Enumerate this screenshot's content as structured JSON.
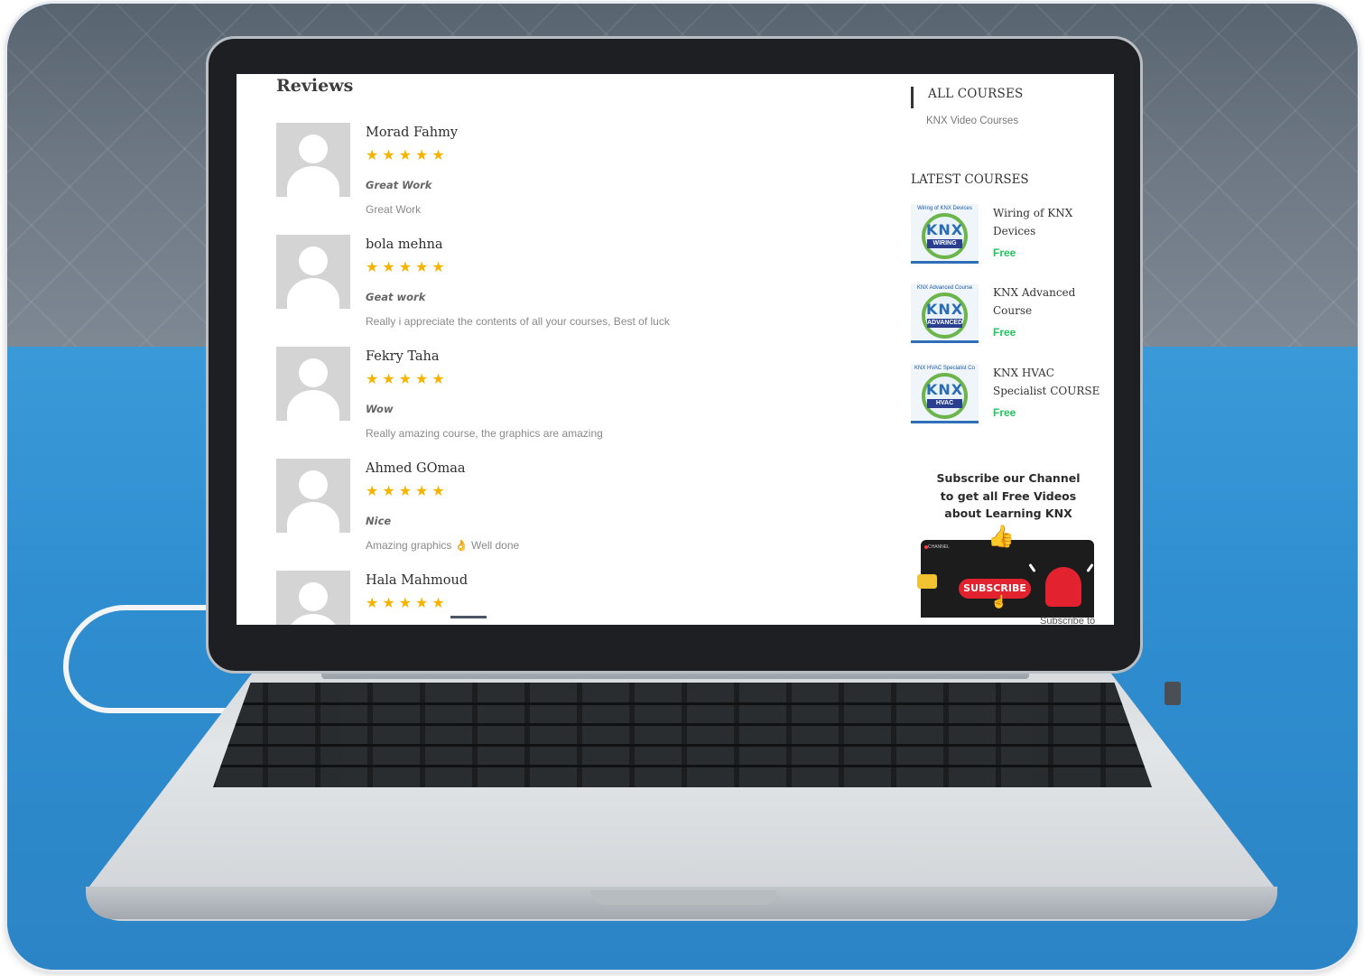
{
  "reviews": {
    "heading": "Reviews",
    "items": [
      {
        "name": "Morad Fahmy",
        "rating": 5,
        "title": "Great Work",
        "body": "Great Work"
      },
      {
        "name": "bola mehna",
        "rating": 5,
        "title": "Geat work",
        "body": "Really i appreciate the contents of all your courses, Best of luck"
      },
      {
        "name": "Fekry Taha",
        "rating": 5,
        "title": "Wow",
        "body": "Really amazing course, the graphics are amazing"
      },
      {
        "name": "Ahmed GOmaa",
        "rating": 5,
        "title": "Nice",
        "body_before": "Amazing graphics",
        "body_emoji": "👌",
        "body_after": "Well done"
      },
      {
        "name": "Hala Mahmoud",
        "rating": 5
      }
    ],
    "star_glyph": "★",
    "star_color": "#f4b400"
  },
  "sidebar": {
    "all_courses": {
      "heading": "ALL COURSES",
      "link": "KNX Video Courses"
    },
    "latest_courses": {
      "heading": "LATEST COURSES",
      "items": [
        {
          "name": "Wiring of KNX Devices",
          "price": "Free",
          "thumb_caption": "Wiring of KNX Devices",
          "thumb_logo": "KNX",
          "thumb_band": "WIRING"
        },
        {
          "name": "KNX Advanced Course",
          "price": "Free",
          "thumb_caption": "KNX Advanced Course",
          "thumb_logo": "KNX",
          "thumb_band": "ADVANCED"
        },
        {
          "name": "KNX HVAC Specialist COURSE",
          "price": "Free",
          "thumb_caption": "KNX HVAC Specialist Co",
          "thumb_logo": "KNX",
          "thumb_band": "HVAC"
        }
      ],
      "price_color": "#22c55e"
    },
    "subscribe": {
      "text_line1": "Subscribe our Channel",
      "text_line2": "to get all Free Videos",
      "text_line3": "about Learning KNX",
      "promo_label": "CHANNEL",
      "button": "SUBSCRIBE",
      "trailing": "Subscribe to",
      "accent": "#e3222f"
    }
  },
  "icons": {
    "avatar": "default-user-avatar",
    "thumbs_up": "thumbs-up-icon",
    "bell": "bell-icon",
    "camera": "camera-icon",
    "cursor": "hand-pointer-icon"
  }
}
